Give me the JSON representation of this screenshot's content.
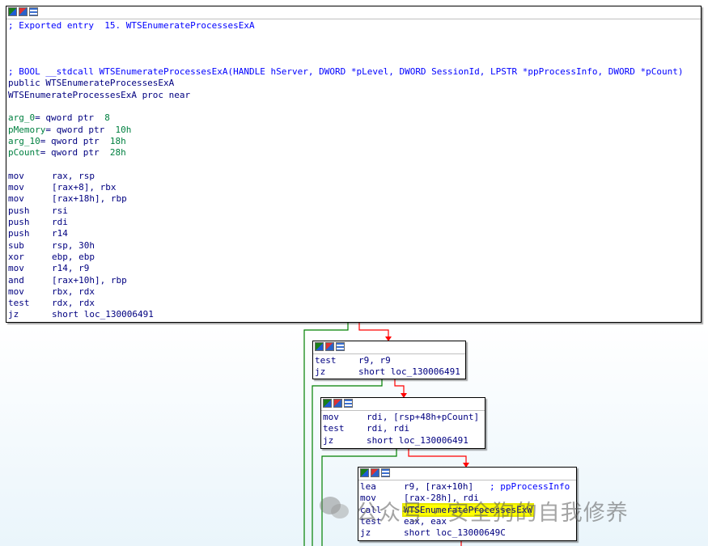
{
  "main_node": {
    "lines": [
      {
        "type": "comment",
        "text": "; Exported entry  15. WTSEnumerateProcessesExA"
      },
      {
        "type": "blank",
        "text": ""
      },
      {
        "type": "blank",
        "text": ""
      },
      {
        "type": "blank",
        "text": ""
      },
      {
        "type": "comment",
        "text": "; BOOL __stdcall WTSEnumerateProcessesExA(HANDLE hServer, DWORD *pLevel, DWORD SessionId, LPSTR *ppProcessInfo, DWORD *pCount)"
      },
      {
        "type": "text",
        "text": "public WTSEnumerateProcessesExA"
      },
      {
        "type": "text",
        "text": "WTSEnumerateProcessesExA proc near"
      },
      {
        "type": "blank",
        "text": ""
      },
      {
        "type": "var",
        "name": "arg_0",
        "rest": "= qword ptr ",
        "num": " 8"
      },
      {
        "type": "var",
        "name": "pMemory",
        "rest": "= qword ptr ",
        "num": " 10h"
      },
      {
        "type": "var",
        "name": "arg_10",
        "rest": "= qword ptr ",
        "num": " 18h"
      },
      {
        "type": "var",
        "name": "pCount",
        "rest": "= qword ptr ",
        "num": " 28h"
      },
      {
        "type": "blank",
        "text": ""
      },
      {
        "type": "ins",
        "op": "mov",
        "args": "rax, rsp"
      },
      {
        "type": "ins",
        "op": "mov",
        "args": "[rax+8], rbx",
        "num": "8"
      },
      {
        "type": "ins",
        "op": "mov",
        "args": "[rax+18h], rbp",
        "num": "18h"
      },
      {
        "type": "ins",
        "op": "push",
        "args": "rsi"
      },
      {
        "type": "ins",
        "op": "push",
        "args": "rdi"
      },
      {
        "type": "ins",
        "op": "push",
        "args": "r14"
      },
      {
        "type": "ins",
        "op": "sub",
        "args": "rsp, 30h",
        "num": "30h"
      },
      {
        "type": "ins",
        "op": "xor",
        "args": "ebp, ebp"
      },
      {
        "type": "ins",
        "op": "mov",
        "args": "r14, r9"
      },
      {
        "type": "ins",
        "op": "and",
        "args": "[rax+10h], rbp",
        "num": "10h"
      },
      {
        "type": "ins",
        "op": "mov",
        "args": "rbx, rdx"
      },
      {
        "type": "ins",
        "op": "test",
        "args": "rdx, rdx"
      },
      {
        "type": "ins",
        "op": "jz",
        "args": "short loc_130006491"
      }
    ]
  },
  "node2": {
    "lines": [
      {
        "op": "test",
        "args": "r9, r9"
      },
      {
        "op": "jz",
        "args": "short loc_130006491"
      }
    ]
  },
  "node3": {
    "lines": [
      {
        "op": "mov",
        "args": "rdi, [rsp+48h+pCount]"
      },
      {
        "op": "test",
        "args": "rdi, rdi"
      },
      {
        "op": "jz",
        "args": "short loc_130006491"
      }
    ]
  },
  "node4": {
    "lines": [
      {
        "op": "lea",
        "args": "r9, [rax+10h]",
        "comment": "   ; ppProcessInfo"
      },
      {
        "op": "mov",
        "args": "[rax-28h], rdi"
      },
      {
        "op": "call",
        "args": "WTSEnumerateProcessesExW",
        "highlight": true
      },
      {
        "op": "test",
        "args": "eax, eax"
      },
      {
        "op": "jz",
        "args": "short loc_13000649C"
      }
    ]
  },
  "watermark": {
    "text": "公众号 · 安全狗的自我修养"
  },
  "colors": {
    "code": "#000080",
    "comment": "#0000ff",
    "number": "#008040",
    "edge_true": "#008000",
    "edge_false": "#ff0000",
    "highlight": "#ffff00"
  }
}
